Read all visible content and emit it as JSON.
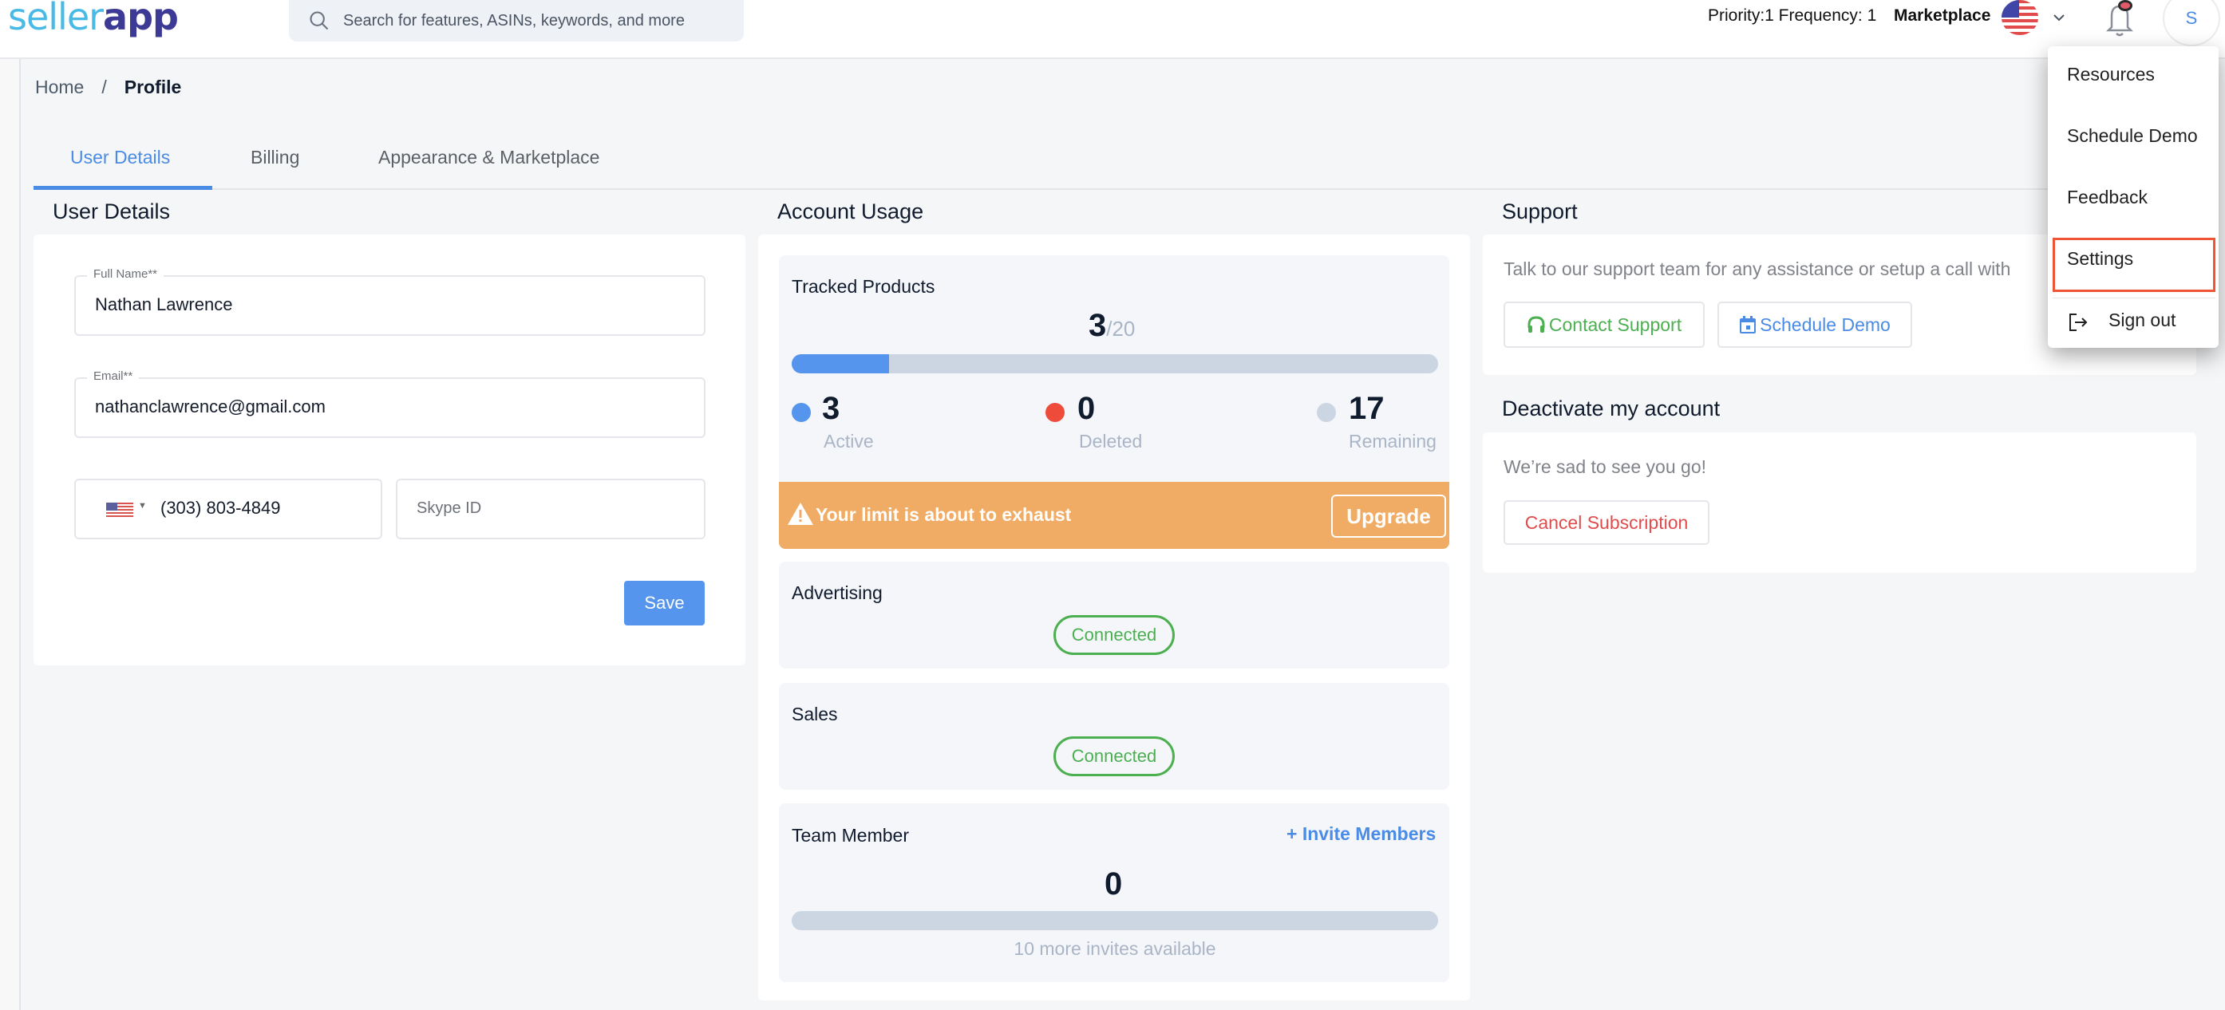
{
  "header": {
    "logo_part1": "seller",
    "logo_part2": "app",
    "search_placeholder": "Search for features, ASINs, keywords, and more",
    "priority_frequency": "Priority:1 Frequency: 1",
    "marketplace_label": "Marketplace",
    "marketplace_flag": "us-flag-icon",
    "avatar_initial": "S"
  },
  "breadcrumb": {
    "home": "Home",
    "separator": "/",
    "current": "Profile"
  },
  "tabs": [
    {
      "label": "User Details",
      "active": true
    },
    {
      "label": "Billing",
      "active": false
    },
    {
      "label": "Appearance & Marketplace",
      "active": false
    }
  ],
  "user_details": {
    "title": "User Details",
    "full_name_label": "Full Name**",
    "full_name_value": "Nathan Lawrence",
    "email_label": "Email**",
    "email_value": "nathanclawrence@gmail.com",
    "phone_value": "(303) 803-4849",
    "skype_placeholder": "Skype ID",
    "save_label": "Save"
  },
  "account_usage": {
    "title": "Account Usage",
    "tracked_products": {
      "title": "Tracked Products",
      "used": "3",
      "total": "/20",
      "progress_fraction": 0.15,
      "active_count": "3",
      "active_label": "Active",
      "deleted_count": "0",
      "deleted_label": "Deleted",
      "remaining_count": "17",
      "remaining_label": "Remaining"
    },
    "warning": {
      "text": "Your limit is about to exhaust",
      "upgrade_label": "Upgrade"
    },
    "advertising": {
      "title": "Advertising",
      "status": "Connected"
    },
    "sales": {
      "title": "Sales",
      "status": "Connected"
    },
    "team_member": {
      "title": "Team Member",
      "invite_label": "+ Invite Members",
      "count": "0",
      "progress_fraction": 0,
      "invites_text": "10 more invites available"
    }
  },
  "support": {
    "title": "Support",
    "text": "Talk to our support team for any assistance or setup a call with",
    "contact_label": "Contact Support",
    "schedule_label": "Schedule Demo"
  },
  "deactivate": {
    "title": "Deactivate my account",
    "text": "We’re sad to see you go!",
    "cancel_label": "Cancel Subscription"
  },
  "dropdown": {
    "items": [
      {
        "label": "Resources"
      },
      {
        "label": "Schedule Demo"
      },
      {
        "label": "Feedback"
      },
      {
        "label": "Settings",
        "highlighted": true
      },
      {
        "label": "Sign out",
        "icon": "sign-out-icon"
      }
    ]
  },
  "colors": {
    "accent": "#4a8be6",
    "warning": "#f0ac64",
    "success": "#4caf50",
    "danger": "#e04c4c",
    "highlight_border": "#ef5535"
  }
}
